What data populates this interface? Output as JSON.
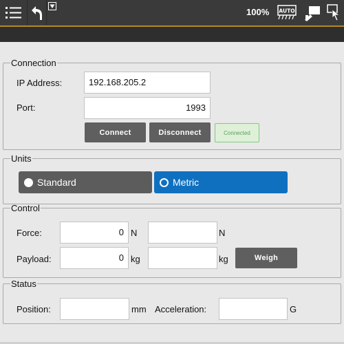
{
  "topbar": {
    "menu_icon": "hamburger-list-icon",
    "back_icon": "back-arrow-icon",
    "dropdown_icon": "triangle-down-icon",
    "zoom": "100%",
    "auto_label": "AUTO",
    "pendant_icon": "teach-pendant-icon",
    "pointer_icon": "hand-pointer-icon"
  },
  "connection": {
    "legend": "Connection",
    "ip_label": "IP Address:",
    "ip_value": "192.168.205.2",
    "port_label": "Port:",
    "port_value": "1993",
    "connect_label": "Connect",
    "disconnect_label": "Disconnect",
    "status_badge": "Connected"
  },
  "units": {
    "legend": "Units",
    "standard_label": "Standard",
    "metric_label": "Metric",
    "selected": "Metric"
  },
  "control": {
    "legend": "Control",
    "force_label": "Force:",
    "force_value": "0",
    "force_unit": "N",
    "force2_value": "",
    "force2_unit": "N",
    "payload_label": "Payload:",
    "payload_value": "0",
    "payload_unit": "kg",
    "payload2_value": "",
    "payload2_unit": "kg",
    "weigh_label": "Weigh"
  },
  "status": {
    "legend": "Status",
    "position_label": "Position:",
    "position_value": "",
    "position_unit": "mm",
    "accel_label": "Acceleration:",
    "accel_value": "",
    "accel_unit": "G"
  },
  "colors": {
    "topbar": "#3a3a3a",
    "accent_gold": "#b88a1e",
    "selected_blue": "#1070c0",
    "button_gray": "#5f5f5f",
    "connected_green": "#7fc97f"
  }
}
